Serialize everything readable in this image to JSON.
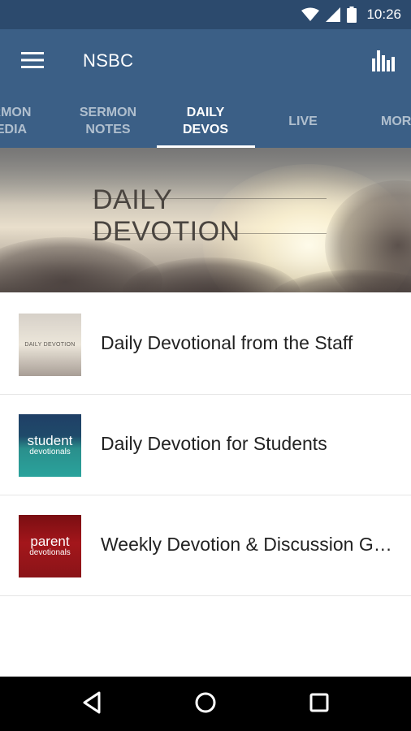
{
  "status_bar": {
    "time": "10:26",
    "icons": [
      "wifi-icon",
      "signal-icon",
      "battery-icon"
    ]
  },
  "app_bar": {
    "title": "NSBC",
    "menu_icon": "hamburger-menu-icon",
    "action_icon": "bar-chart-icon"
  },
  "tabs": [
    {
      "label": "RMON\nEDIA",
      "active": false
    },
    {
      "label": "SERMON\nNOTES",
      "active": false
    },
    {
      "label": "DAILY\nDEVOS",
      "active": true
    },
    {
      "label": "LIVE",
      "active": false
    },
    {
      "label": "MOR",
      "active": false
    }
  ],
  "hero": {
    "title": "DAILY DEVOTION"
  },
  "list": [
    {
      "label": "Daily Devotional from the Staff",
      "thumb_line1": "DAILY DEVOTION",
      "thumb_line2": ""
    },
    {
      "label": "Daily Devotion for Students",
      "thumb_line1": "student",
      "thumb_line2": "devotionals"
    },
    {
      "label": "Weekly Devotion & Discussion Guide",
      "thumb_line1": "parent",
      "thumb_line2": "devotionals"
    }
  ],
  "nav_bar": {
    "buttons": [
      "back-icon",
      "home-icon",
      "recents-icon"
    ]
  },
  "colors": {
    "status_bar": "#2c4a6d",
    "app_bar": "#3b5f86",
    "text": "#222222"
  }
}
